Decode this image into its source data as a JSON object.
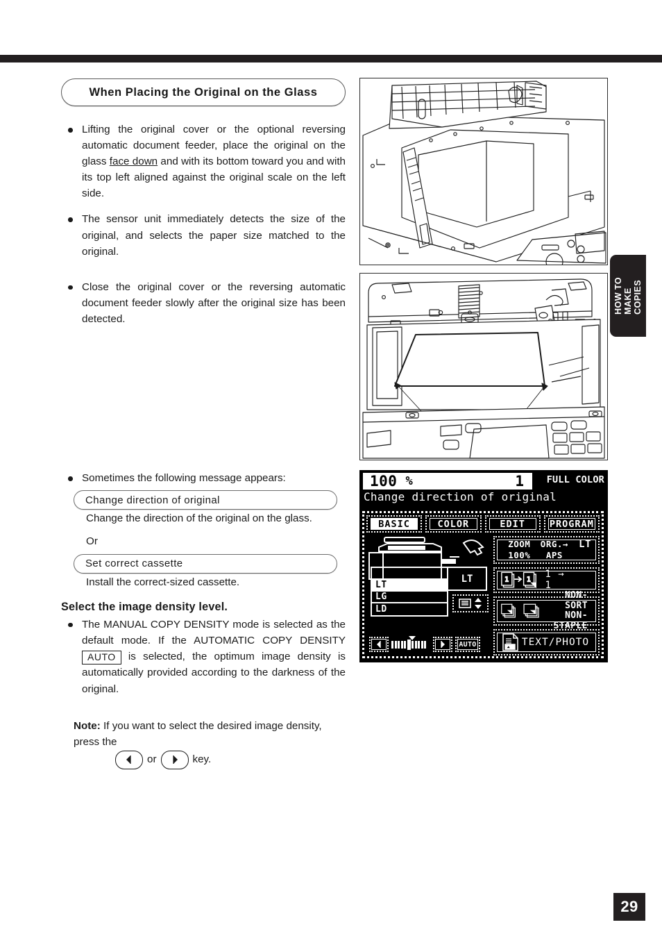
{
  "page": {
    "number": "29",
    "side_tab": {
      "line1": "HOW TO",
      "line2": "MAKE",
      "line3": "COPIES"
    }
  },
  "section": {
    "heading": "When Placing the Original on the Glass",
    "bullets": [
      "Lifting the original cover or the optional reversing automatic document feeder, place the original on the glass ",
      "The sensor unit immediately detects the size of the original, and selects the paper size matched to the original.",
      "Close the original cover or the reversing automatic document feeder slowly after the original size has been detected."
    ],
    "bullet1_underlined": "face down",
    "bullet1_tail": " and with its bottom toward you and with its top left aligned against the original scale on the left side."
  },
  "messages": {
    "intro": "Sometimes the following message appears:",
    "msg1": "Change direction of original",
    "msg1_desc": "Change the direction of the original on the glass.",
    "or": "Or",
    "msg2": "Set correct cassette",
    "msg2_desc": "Install the correct-sized cassette."
  },
  "density": {
    "heading": "Select the image density level.",
    "body_a": "The MANUAL COPY DENSITY mode is selected as the default mode. If the AUTOMATIC COPY DENSITY ",
    "auto_key": "AUTO",
    "body_b": " is selected, the optimum image density is automatically provided according to the darkness of the original.",
    "note_label": "Note:",
    "note_a": "If you want to select the desired image density, press the ",
    "note_or": "or",
    "note_b": "key."
  },
  "figures": {
    "top_caption": "copier-with-cover-lifted-original-on-glass",
    "bottom_caption": "copier-platen-original-aligned-to-scale"
  },
  "lcd": {
    "zoom_value": "100",
    "percent_sign": "%",
    "copy_count": "1",
    "color_mode": "FULL COLOR",
    "message": "Change direction of original",
    "tabs": [
      {
        "label": "BASIC",
        "active": true
      },
      {
        "label": "COLOR",
        "active": false
      },
      {
        "label": "EDIT",
        "active": false
      },
      {
        "label": "PROGRAM",
        "active": false
      }
    ],
    "cassettes": [
      {
        "label": "",
        "selected": false
      },
      {
        "label": "LT",
        "selected": true
      },
      {
        "label": "LG",
        "selected": false
      },
      {
        "label": "LD",
        "selected": false
      }
    ],
    "current_paper": "LT",
    "density_auto_label": "AUTO",
    "density_ticks": 11,
    "density_pointer_index": 5,
    "zoom_box": {
      "left_top": "ZOOM",
      "left_bottom": "100%",
      "mid_top": "ORG.",
      "mid_arrow": "→",
      "mid_bottom": "APS",
      "right": "LT"
    },
    "duplex_label": "1 → 1",
    "finisher_label_line1": "NON-SORT",
    "finisher_label_line2": "NON-STAPLE",
    "original_mode_label": "TEXT/PHOTO"
  },
  "colors": {
    "ink": "#231f20",
    "lcd_bg": "#000000",
    "lcd_fg": "#ffffff"
  }
}
